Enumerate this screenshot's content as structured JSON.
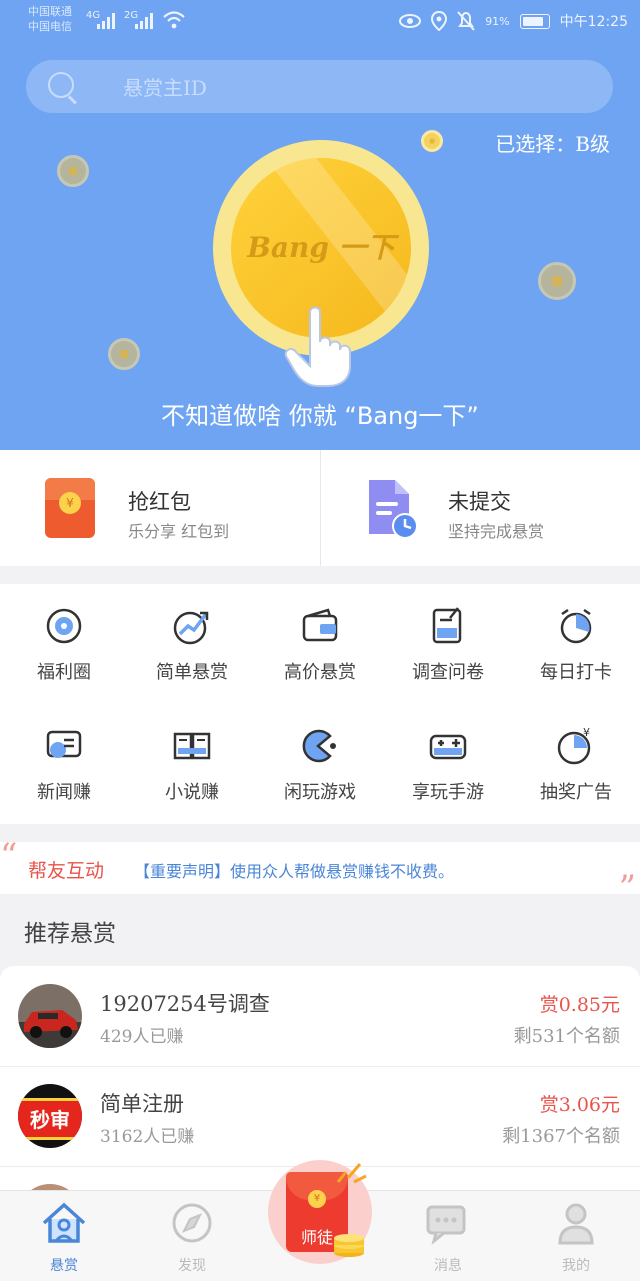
{
  "status": {
    "carrier1": "中国联通",
    "carrier2": "中国电信",
    "net1": "4G",
    "net2": "2G",
    "battery": "91%",
    "time": "中午12:25"
  },
  "search": {
    "placeholder": "悬赏主ID"
  },
  "selected_level": "已选择：B级",
  "coin_text": "Bang 一下",
  "slogan": "不知道做啥 你就 “Bang一下”",
  "quick": [
    {
      "title": "抢红包",
      "sub": "乐分享 红包到",
      "icon": "red-packet-icon",
      "coin": "¥"
    },
    {
      "title": "未提交",
      "sub": "坚持完成悬赏",
      "icon": "document-clock-icon"
    }
  ],
  "grid": [
    {
      "label": "福利圈",
      "icon": "target-icon"
    },
    {
      "label": "简单悬赏",
      "icon": "growth-icon"
    },
    {
      "label": "高价悬赏",
      "icon": "wallet-icon"
    },
    {
      "label": "调查问卷",
      "icon": "clipboard-icon"
    },
    {
      "label": "每日打卡",
      "icon": "alarm-icon"
    },
    {
      "label": "新闻赚",
      "icon": "chat-icon"
    },
    {
      "label": "小说赚",
      "icon": "book-icon"
    },
    {
      "label": "闲玩游戏",
      "icon": "pacman-icon"
    },
    {
      "label": "享玩手游",
      "icon": "gamepad-icon"
    },
    {
      "label": "抽奖广告",
      "icon": "money-dial-icon"
    }
  ],
  "notice": {
    "tag": "帮友互动",
    "message": "【重要声明】使用众人帮做悬赏赚钱不收费。",
    "open_quote": "“",
    "close_quote": "”"
  },
  "section_title": "推荐悬赏",
  "tasks": [
    {
      "name": "19207254号调查",
      "earned": "429人已赚",
      "reward": "赏0.85元",
      "quota": "剩531个名额",
      "avatar": "car-avatar"
    },
    {
      "name": "简单注册",
      "earned": "3162人已赚",
      "reward": "赏3.06元",
      "quota": "剩1367个名额",
      "avatar": "logo-avatar",
      "avatar_text": "秒审"
    }
  ],
  "tabs": [
    {
      "label": "悬赏",
      "icon": "home-icon",
      "active": true
    },
    {
      "label": "发现",
      "icon": "compass-icon",
      "active": false
    },
    {
      "label": "师徒",
      "icon": "red-envelope-icon",
      "active": false
    },
    {
      "label": "消息",
      "icon": "message-icon",
      "active": false
    },
    {
      "label": "我的",
      "icon": "user-icon",
      "active": false
    }
  ],
  "colors": {
    "hero": "#6ea4f2",
    "accent": "#4a86d8",
    "reward": "#e8534a",
    "coin": "#f5b81d"
  }
}
